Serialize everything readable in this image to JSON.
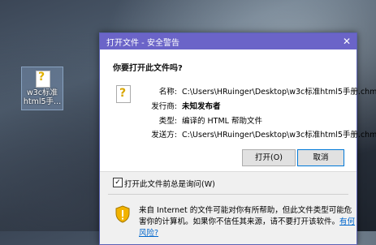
{
  "desktop_icon": {
    "label_line1": "w3c标准",
    "label_line2": "html5手..."
  },
  "dialog": {
    "title": "打开文件 - 安全警告",
    "close_glyph": "✕",
    "heading": "你要打开此文件吗?",
    "fields": [
      {
        "key": "名称:",
        "value": "C:\\Users\\HRuinger\\Desktop\\w3c标准html5手册.chm"
      },
      {
        "key": "发行商:",
        "value": "未知发布者"
      },
      {
        "key": "类型:",
        "value": "编译的 HTML 帮助文件"
      },
      {
        "key": "发送方:",
        "value": "C:\\Users\\HRuinger\\Desktop\\w3c标准html5手册.chm"
      }
    ],
    "open_button": "打开(O)",
    "cancel_button": "取消",
    "checkbox_label": "打开此文件前总是询问(W)",
    "checkbox_checked": "✓",
    "info_text": "来自 Internet 的文件可能对你有所帮助，但此文件类型可能危害你的计算机。如果你不信任其来源，请不要打开该软件。",
    "info_link": "有何风险?"
  }
}
